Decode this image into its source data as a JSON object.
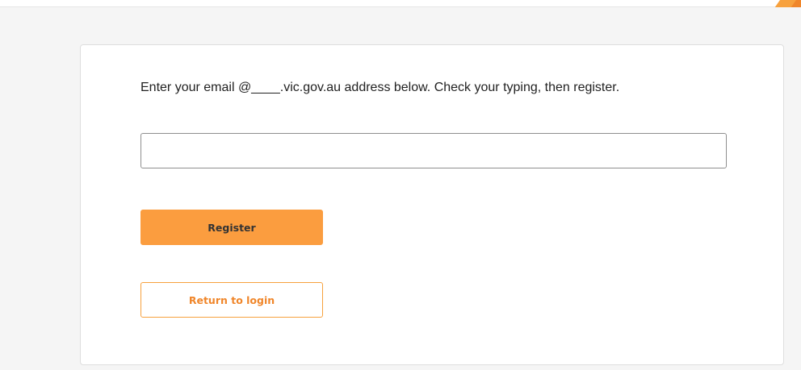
{
  "form": {
    "instruction": "Enter your email @____.vic.gov.au address below. Check your typing, then register.",
    "email_value": "",
    "email_placeholder": ""
  },
  "buttons": {
    "register_label": "Register",
    "return_label": "Return to login"
  },
  "colors": {
    "accent": "#f7a13d",
    "accent_dark": "#f0862a",
    "register_bg": "#fb9d3f",
    "page_bg": "#f5f5f5"
  }
}
